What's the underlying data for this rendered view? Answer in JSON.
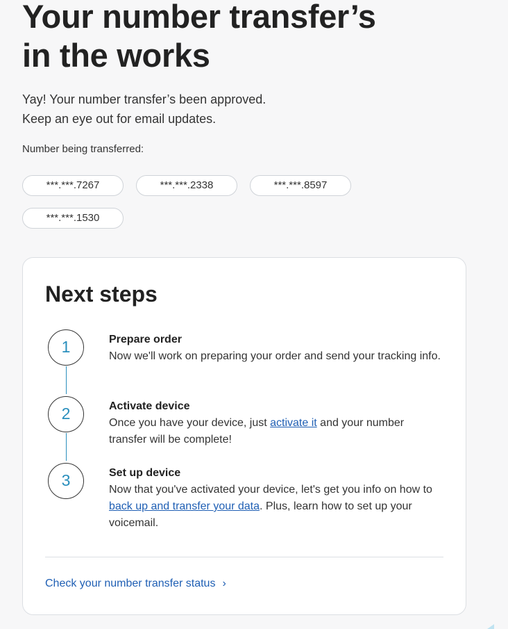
{
  "hero": {
    "title_line1": "Your number transfer’s",
    "title_line2": "in the works",
    "subtext_line1": "Yay! Your number transfer’s been approved.",
    "subtext_line2": "Keep an eye out for email updates."
  },
  "numbers": {
    "label": "Number being transferred:",
    "items": [
      "***.***.7267",
      "***.***.2338",
      "***.***.8597",
      "***.***.1530"
    ]
  },
  "next_steps": {
    "title": "Next steps",
    "steps": [
      {
        "number": "1",
        "title": "Prepare order",
        "text": "Now we'll work on preparing your order and send your tracking info."
      },
      {
        "number": "2",
        "title": "Activate device",
        "text_before": "Once you have your device, just ",
        "link": "activate it",
        "text_after": " and your number transfer will be complete!"
      },
      {
        "number": "3",
        "title": "Set up device",
        "text_before": "Now that you've activated your device, let's get you info on how to ",
        "link": "back up and transfer your data",
        "text_after": ". Plus, learn how to set up your voicemail."
      }
    ],
    "status_link": "Check your number transfer status",
    "status_chevron": "›"
  },
  "colors": {
    "accent": "#2a8fbd",
    "link": "#1f5fb4",
    "background": "#f7f7f8"
  }
}
